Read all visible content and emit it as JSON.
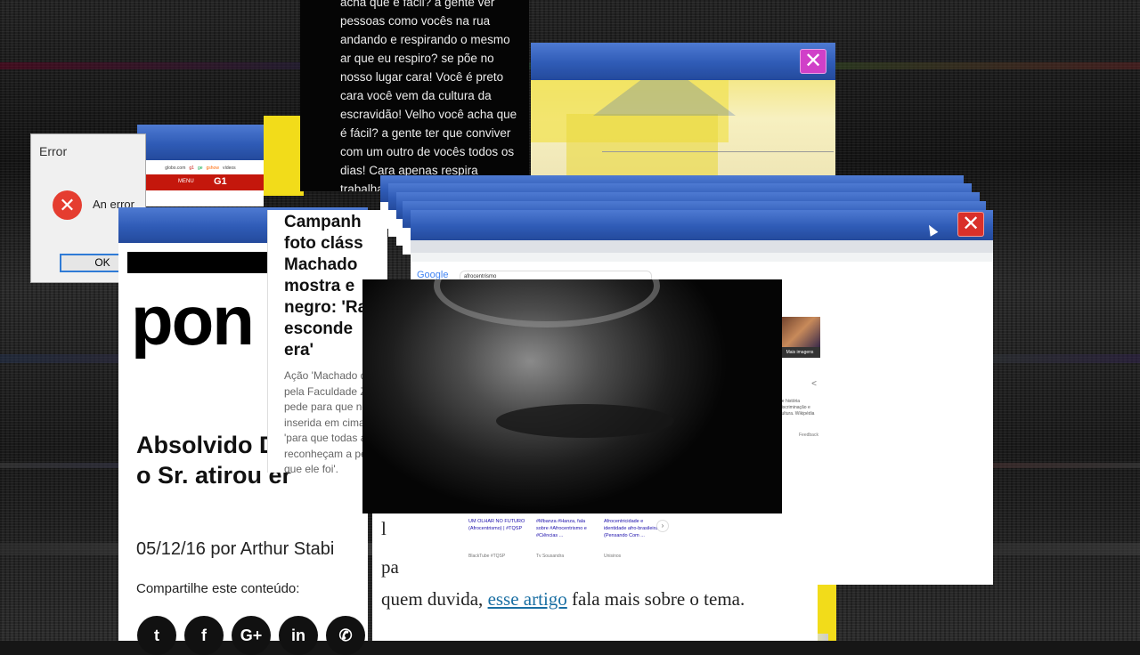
{
  "error_dialog": {
    "title": "Error",
    "message": "An error",
    "ok_label": "OK"
  },
  "globo_window": {
    "nav_items": [
      "globo.com",
      "g1",
      "ge",
      "gshow",
      "vídeos"
    ],
    "menu_label": "MENU",
    "brand": "G1"
  },
  "chat_window": {
    "text": "acha que é fácil? a gente ver pessoas como vocês na rua andando e respirando o mesmo ar que eu respiro? se põe no nosso lugar cara! Você é preto cara você vem da cultura da escravidão! Velho você acha que é fácil? a gente ter que conviver com um outro de vocês todos os dias! Cara apenas respira trabalha e pronto cara você é preto porra e você não tem vez! Você é"
  },
  "campaign_window": {
    "headline_lines": [
      "Campanh",
      "foto cláss",
      "Machado",
      "mostra e",
      "negro: 'Ra",
      "esconde",
      "era'"
    ],
    "body": "Ação 'Machado d pela Faculdade Z pede para que no inserida em cima 'para que todas a reconheçam a pe que ele foi'."
  },
  "article_window": {
    "logo_text": "pon",
    "headline": "Absolvido Douglas, autor da que o Sr. atirou er",
    "byline": "05/12/16 por Arthur Stabi",
    "share_label": "Compartilhe este conteúdo:",
    "social_icons": [
      "twitter-icon",
      "facebook-icon",
      "google-plus-icon",
      "linkedin-icon",
      "whatsapp-icon"
    ],
    "social_glyphs": [
      "t",
      "f",
      "G+",
      "in",
      "✆"
    ]
  },
  "browser_window": {
    "google_logo": "Google",
    "search_query": "afrocentrismo",
    "video_cards": [
      {
        "title": "UM OLHAR NO FUTURO (Afrocentrismo) | #TQSP",
        "channel": "BlackTube #TQSP"
      },
      {
        "title": "#Mbanza #Hanza, fala sobre #Afrocentrismo e #Ciências ...",
        "channel": "Tv Sousandra"
      },
      {
        "title": "Afrocentricidade e identidade afro-brasileira (Pensando Com ...",
        "channel": "Unisinos"
      }
    ],
    "knowledge_label": "Mais imagens",
    "knowledge_snippet": "de história discriminação e cultura. Wikipédia",
    "feedback": "Feedback"
  },
  "doc_window": {
    "letter_1": "l",
    "letter_2": "pa",
    "text_before": "quem duvida, ",
    "link_text": "esse artigo",
    "text_after": " fala mais sobre o tema."
  },
  "colors": {
    "titlebar_blue": "#2f5bb6",
    "close_red": "#d9302a",
    "close_magenta": "#d040c8",
    "accent_yellow": "#f2dc1a",
    "link_blue": "#1a6fa3"
  }
}
